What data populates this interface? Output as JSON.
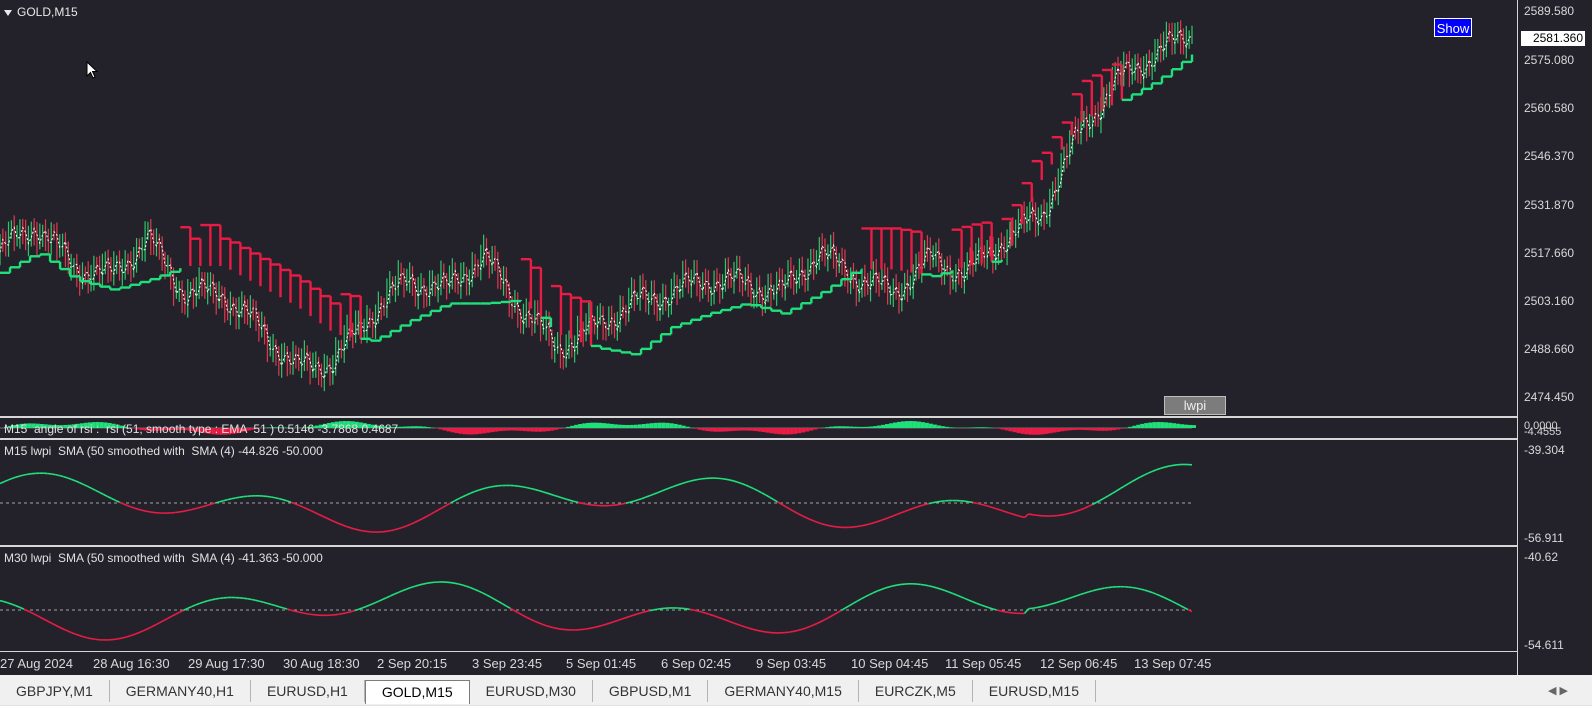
{
  "symbol": "GOLD,M15",
  "show_button": "Show",
  "lwpi_button": "lwpi",
  "current_price": "2581.360",
  "price_labels": [
    "2589.580",
    "2575.080",
    "2560.580",
    "2546.370",
    "2531.870",
    "2517.660",
    "2503.160",
    "2488.660",
    "2474.450"
  ],
  "rsi_pane": {
    "title": "M15  angle of rsi :  rsi (51, smooth type : EMA  51 ) 0.5146 -3.7868 0.4687",
    "scale_top": "0.0000",
    "scale_bottom": "-4.4555"
  },
  "m15_pane": {
    "title": "M15 lwpi  SMA (50 smoothed with  SMA (4) -44.826 -50.000",
    "scale_top": "-39.304",
    "scale_bottom": "-56.911"
  },
  "m30_pane": {
    "title": "M30 lwpi  SMA (50 smoothed with  SMA (4) -41.363 -50.000",
    "scale_top": "-40.62",
    "scale_bottom": "-54.611"
  },
  "time_labels": [
    "27 Aug 2024",
    "28 Aug 16:30",
    "29 Aug 17:30",
    "30 Aug 18:30",
    "2 Sep 20:15",
    "3 Sep 23:45",
    "5 Sep 01:45",
    "6 Sep 02:45",
    "9 Sep 03:45",
    "10 Sep 04:45",
    "11 Sep 05:45",
    "12 Sep 06:45",
    "13 Sep 07:45"
  ],
  "tabs": [
    "GBPJPY,M1",
    "GERMANY40,H1",
    "EURUSD,H1",
    "GOLD,M15",
    "EURUSD,M30",
    "GBPUSD,M1",
    "GERMANY40,M15",
    "EURCZK,M5",
    "EURUSD,M15"
  ],
  "active_tab": "GOLD,M15",
  "tab_arrows": "◀ ▶",
  "colors": {
    "background": "#23222b",
    "bull_line": "#1fe07a",
    "bear_line": "#e81c45",
    "price_text": "#d8d8d8",
    "show_button": "#0000ff"
  },
  "chart_data": {
    "type": "line",
    "title": "GOLD,M15",
    "x": [
      "27 Aug 2024",
      "28 Aug 16:30",
      "29 Aug 17:30",
      "30 Aug 18:30",
      "2 Sep 20:15",
      "3 Sep 23:45",
      "5 Sep 01:45",
      "6 Sep 02:45",
      "9 Sep 03:45",
      "10 Sep 04:45",
      "11 Sep 05:45",
      "12 Sep 06:45",
      "13 Sep 07:45"
    ],
    "series": [
      {
        "values": [
          2518,
          2526,
          2514,
          2511,
          2522,
          2506,
          2506,
          2496,
          2484,
          2486,
          2500,
          2510,
          2507,
          2517,
          2502,
          2490,
          2496,
          2503,
          2506,
          2510,
          2509,
          2506,
          2518,
          2511,
          2506,
          2516,
          2512,
          2522,
          2529,
          2553,
          2568,
          2576,
          2582
        ]
      },
      {
        "values": [
          2512,
          2518,
          2510,
          2507,
          2510,
          2514,
          2514,
          2508,
          2502,
          2494,
          2492,
          2498,
          2503,
          2503,
          2504,
          2494,
          2490,
          2488,
          2496,
          2500,
          2503,
          2500,
          2506,
          2513,
          2513,
          2511,
          2514,
          2516,
          2540,
          2556,
          2562,
          2568,
          2576
        ]
      }
    ],
    "ylim": [
      2470,
      2592
    ]
  }
}
